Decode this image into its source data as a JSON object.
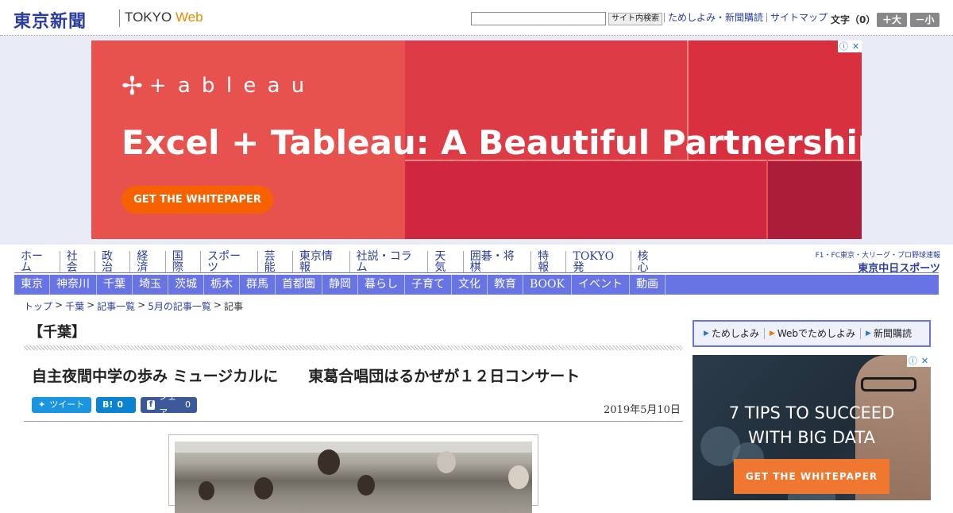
{
  "header": {
    "logo_jp": "東京新聞",
    "logo_en_main": "TOKYO ",
    "logo_en_web": "Web",
    "search_button": "サイト内検索",
    "links": [
      "ためしよみ・新聞購読",
      "サイトマップ"
    ],
    "font_size_label": "文字（0）",
    "font_plus": "＋大",
    "font_minus": "－小"
  },
  "banner_ad": {
    "brand": "+ a b l e a u",
    "headline": "Excel + Tableau: A Beautiful Partnership",
    "cta": "GET THE WHITEPAPER",
    "info_icon": "ⓘ",
    "close_icon": "✕"
  },
  "nav_primary": [
    "ホーム",
    "社会",
    "政治",
    "経済",
    "国際",
    "スポーツ",
    "芸能",
    "東京情報",
    "社説・コラム",
    "天気",
    "囲碁・将棋",
    "特報",
    "TOKYO発",
    "核心"
  ],
  "chunichi": {
    "tagline": "F1・FC東京・大リーグ・プロ野球速報",
    "name": "東京中日スポーツ"
  },
  "nav_regional": [
    "東京",
    "神奈川",
    "千葉",
    "埼玉",
    "茨城",
    "栃木",
    "群馬",
    "首都圏",
    "静岡",
    "暮らし",
    "子育て",
    "文化",
    "教育",
    "BOOK",
    "イベント",
    "動画"
  ],
  "breadcrumb": {
    "items": [
      "トップ",
      "千葉",
      "記事一覧",
      "5月の記事一覧"
    ],
    "current": "記事",
    "separator": ">"
  },
  "article": {
    "section": "【千葉】",
    "headline_part1": "自主夜間中学の歩み ミュージカルに",
    "headline_part2": "東葛合唱団はるかぜが１２日コンサート",
    "date": "2019年5月10日",
    "share": {
      "twitter_label": "ツイート",
      "hatena_icon": "B!",
      "hatena_count": "0",
      "facebook_label": "シェア",
      "facebook_count": "0"
    }
  },
  "sidebar": {
    "links": [
      "ためしよみ",
      "Webでためしよみ",
      "新聞購読"
    ],
    "ad": {
      "line1": "7 TIPS TO SUCCEED",
      "line2": "WITH BIG DATA",
      "cta": "GET THE WHITEPAPER"
    }
  },
  "colors": {
    "brand_blue": "#2a3d9c",
    "nav_purple": "#6873e4",
    "ad_red": "#e8524e",
    "ad_orange": "#f76100"
  }
}
